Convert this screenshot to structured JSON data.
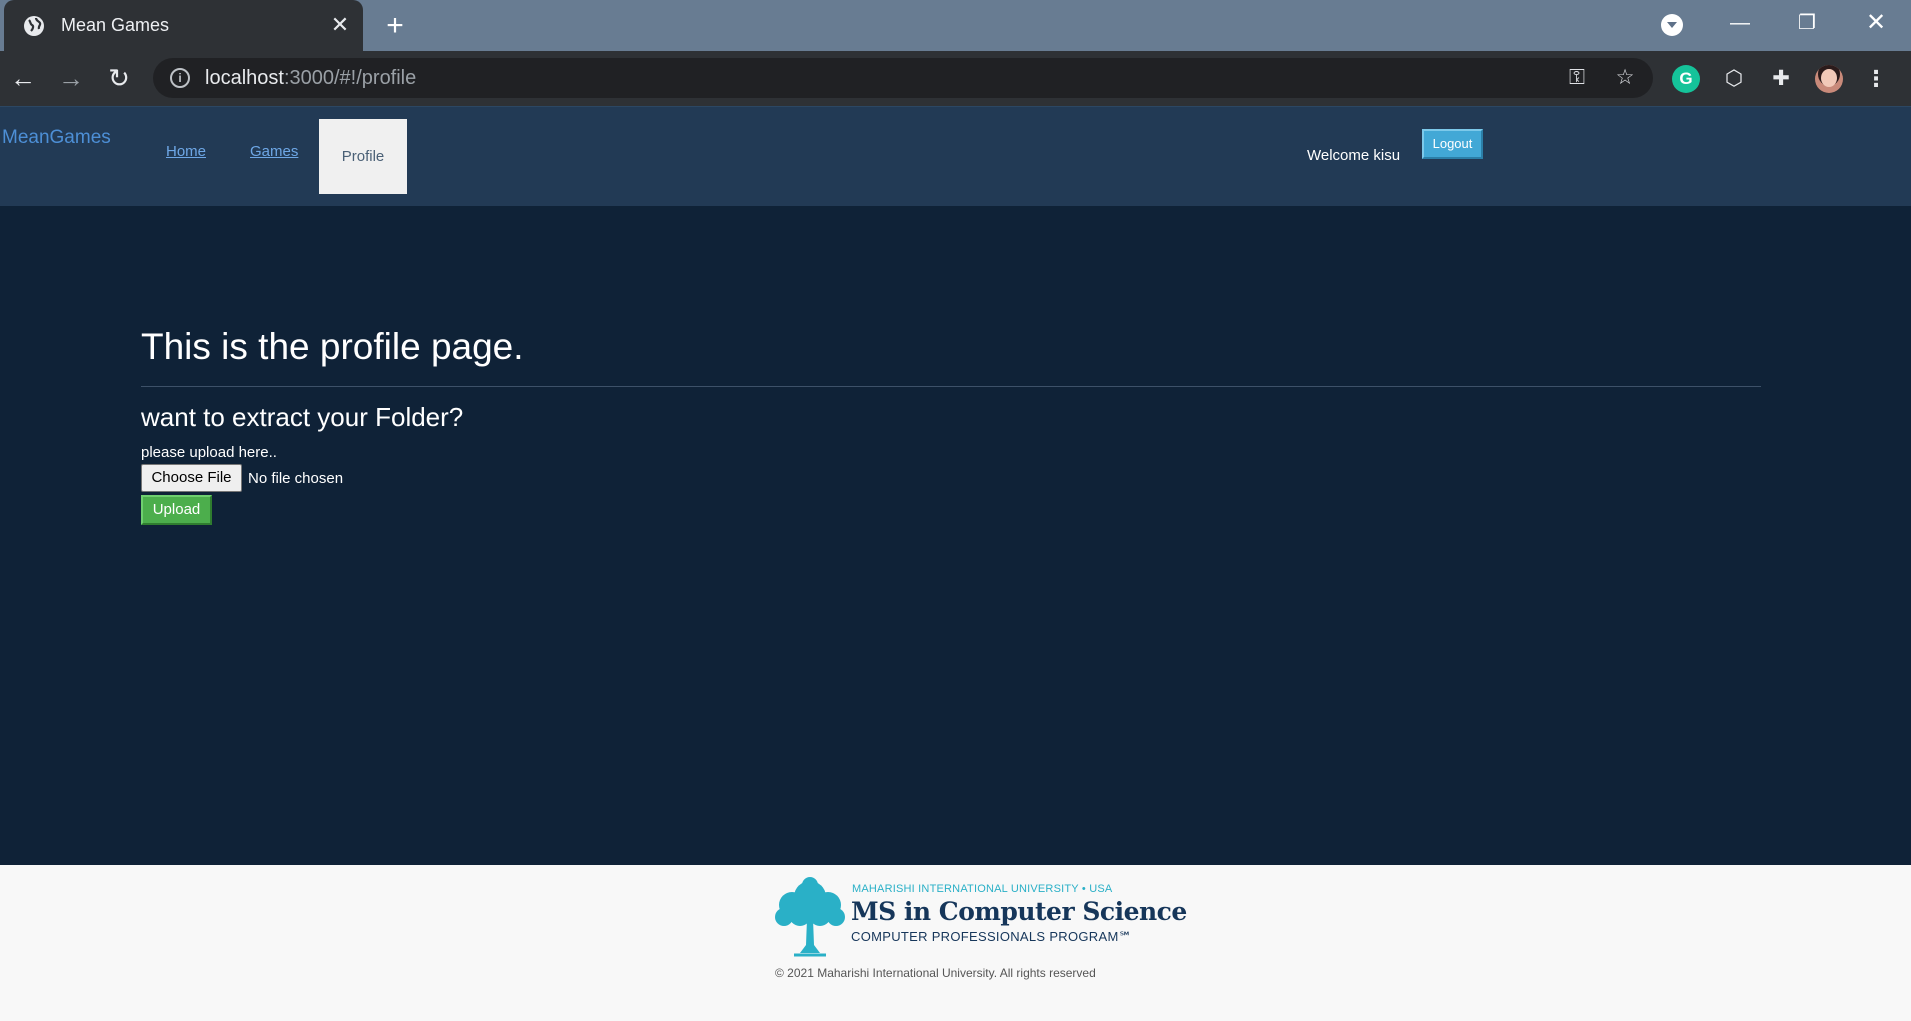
{
  "browser": {
    "tab_title": "Mean Games",
    "url_host": "localhost",
    "url_path": ":3000/#!/profile",
    "icons": [
      "globe-icon",
      "close-icon",
      "plus-icon",
      "back-arrow-icon",
      "forward-arrow-icon",
      "reload-icon",
      "info-icon",
      "key-icon",
      "star-icon",
      "grammarly-icon",
      "cube-icon",
      "puzzle-icon",
      "avatar",
      "kebab-menu-icon"
    ]
  },
  "site": {
    "brand": "MeanGames",
    "nav": {
      "home": "Home",
      "games": "Games",
      "profile": "Profile"
    },
    "welcome": "Welcome kisu",
    "logout": "Logout",
    "colors": {
      "page_bg": "#0f2237",
      "header_bg": "#223a55",
      "link": "#6ea7e6",
      "logout_bg": "#42a8d6",
      "upload_bg": "#4cae4c"
    }
  },
  "main": {
    "heading": "This is the profile page.",
    "subheading": "want to extract your Folder?",
    "upload_label": "please upload here..",
    "choose_file": "Choose File",
    "file_status": "No file chosen",
    "upload_button": "Upload"
  },
  "footer": {
    "logo_university": "MAHARISHI INTERNATIONAL UNIVERSITY • USA",
    "logo_title": "MS in Computer Science",
    "logo_subtitle": "COMPUTER PROFESSIONALS PROGRAM℠",
    "copyright": "© 2021 Maharishi International University. All rights reserved"
  }
}
